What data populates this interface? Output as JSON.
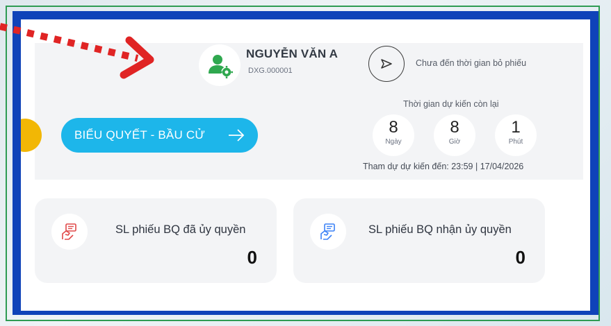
{
  "user": {
    "name": "NGUYỄN VĂN A",
    "code": "DXG.000001"
  },
  "status": {
    "vote_status": "Chưa đến thời gian bỏ phiếu"
  },
  "countdown": {
    "label": "Thời gian dự kiến còn lại",
    "days_value": "8",
    "days_unit": "Ngày",
    "hours_value": "8",
    "hours_unit": "Giờ",
    "minutes_value": "1",
    "minutes_unit": "Phút",
    "deadline": "Tham dự dự kiến đến: 23:59 | 17/04/2026"
  },
  "actions": {
    "vote_button_label": "BIỂU QUYẾT - BẦU CỬ"
  },
  "stats": [
    {
      "label": "SL phiếu BQ đã ủy quyền",
      "value": "0"
    },
    {
      "label": "SL phiếu BQ nhận ủy quyền",
      "value": "0"
    }
  ],
  "colors": {
    "frame_blue": "#0f43b9",
    "button_blue": "#1db6ea",
    "annotation_red": "#e02424",
    "avatar_green": "#2fa84f",
    "yellow": "#f2b705"
  },
  "icons": {
    "avatar": "user-settings-icon",
    "send": "send-arrow-icon",
    "button_arrow": "arrow-right-icon",
    "stat_1": "delegate-hand-icon",
    "stat_2": "delegate-hand-icon"
  }
}
